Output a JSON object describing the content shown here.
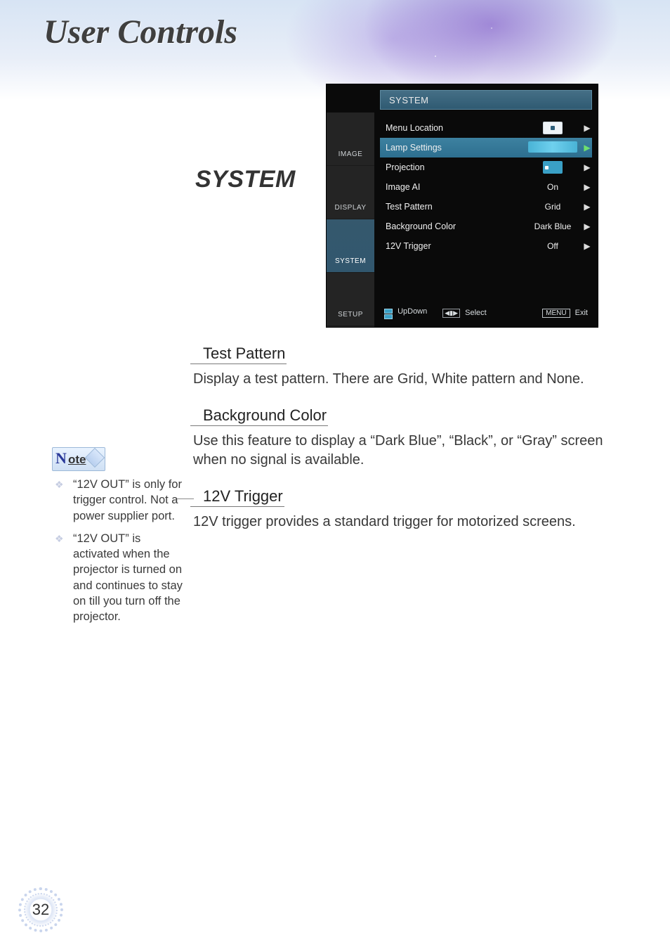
{
  "chapter_title": "User Controls",
  "section_heading": "SYSTEM",
  "osd": {
    "title": "SYSTEM",
    "tabs": [
      {
        "label": "IMAGE",
        "active": false
      },
      {
        "label": "DISPLAY",
        "active": false
      },
      {
        "label": "SYSTEM",
        "active": true
      },
      {
        "label": "SETUP",
        "active": false
      }
    ],
    "rows": [
      {
        "label": "Menu Location",
        "value_icon": "box-dot",
        "value_text": "",
        "highlight": false
      },
      {
        "label": "Lamp Settings",
        "value_icon": "strip",
        "value_text": "",
        "highlight": true
      },
      {
        "label": "Projection",
        "value_icon": "proj",
        "value_text": "",
        "highlight": false
      },
      {
        "label": "Image AI",
        "value_icon": "",
        "value_text": "On",
        "highlight": false
      },
      {
        "label": "Test Pattern",
        "value_icon": "",
        "value_text": "Grid",
        "highlight": false
      },
      {
        "label": "Background Color",
        "value_icon": "",
        "value_text": "Dark Blue",
        "highlight": false
      },
      {
        "label": "12V Trigger",
        "value_icon": "",
        "value_text": "Off",
        "highlight": false
      }
    ],
    "footer": {
      "updown": "UpDown",
      "select": "Select",
      "menu": "MENU",
      "exit": "Exit"
    }
  },
  "items": [
    {
      "heading": "Test Pattern",
      "body": "Display a test pattern. There are Grid, White pattern and None."
    },
    {
      "heading": "Background Color",
      "body": "Use this feature to display a “Dark Blue”, “Black”, or “Gray” screen when no signal is available."
    },
    {
      "heading": "12V Trigger",
      "body": "12V trigger provides a standard trigger for motorized screens."
    }
  ],
  "note": {
    "badge_letter": "N",
    "badge_rest": "ote",
    "bullets": [
      "“12V OUT” is only for trigger control. Not a power supplier port.",
      "“12V OUT” is activated when the projector is turned on and continues to stay on till you turn off the projector."
    ]
  },
  "page_number": "32"
}
